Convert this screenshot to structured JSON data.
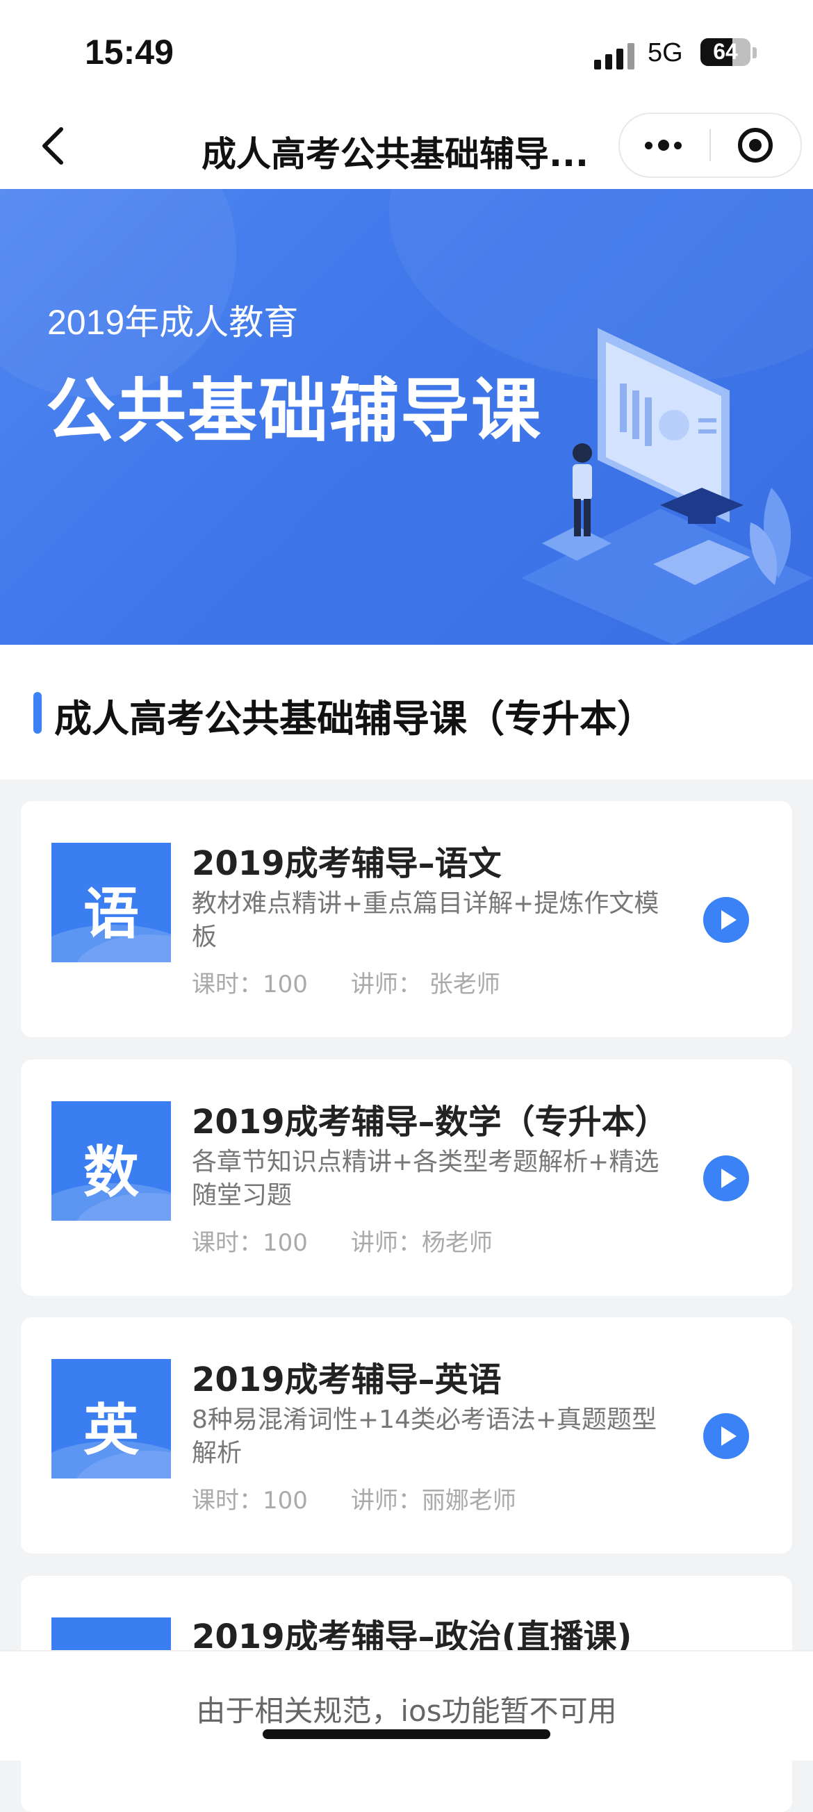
{
  "status_bar": {
    "time": "15:49",
    "network": "5G",
    "battery": "64",
    "battery_level": 0.64
  },
  "nav": {
    "title": "成人高考公共基础辅导..."
  },
  "banner": {
    "subtitle": "2019年成人教育",
    "title": "公共基础辅导课"
  },
  "section": {
    "title": "成人高考公共基础辅导课（专升本）"
  },
  "courses": [
    {
      "icon_char": "语",
      "title": "2019成考辅导–语文",
      "description": "教材难点精讲+重点篇目详解+提炼作文模板",
      "hours_label": "课时：100",
      "teacher_label": "讲师：  张老师"
    },
    {
      "icon_char": "数",
      "title": "2019成考辅导–数学（专升本）",
      "description": "各章节知识点精讲+各类型考题解析+精选随堂习题",
      "hours_label": "课时：100",
      "teacher_label": "讲师：杨老师"
    },
    {
      "icon_char": "英",
      "title": "2019成考辅导–英语",
      "description": "8种易混淆词性+14类必考语法+真题题型解析",
      "hours_label": "课时：100",
      "teacher_label": "讲师：丽娜老师"
    },
    {
      "icon_char": "",
      "title": "2019成考辅导–政治(直播课)",
      "description": "",
      "hours_label": "",
      "teacher_label": ""
    }
  ],
  "footer": {
    "notice": "由于相关规范，ios功能暂不可用"
  },
  "colors": {
    "accent": "#3b82f6",
    "banner": "#3f77ea",
    "thumb": "#3a7ef1"
  },
  "icons": {
    "back": "chevron-left-icon",
    "more": "more-dots-icon",
    "close": "target-close-icon",
    "play": "play-icon"
  }
}
